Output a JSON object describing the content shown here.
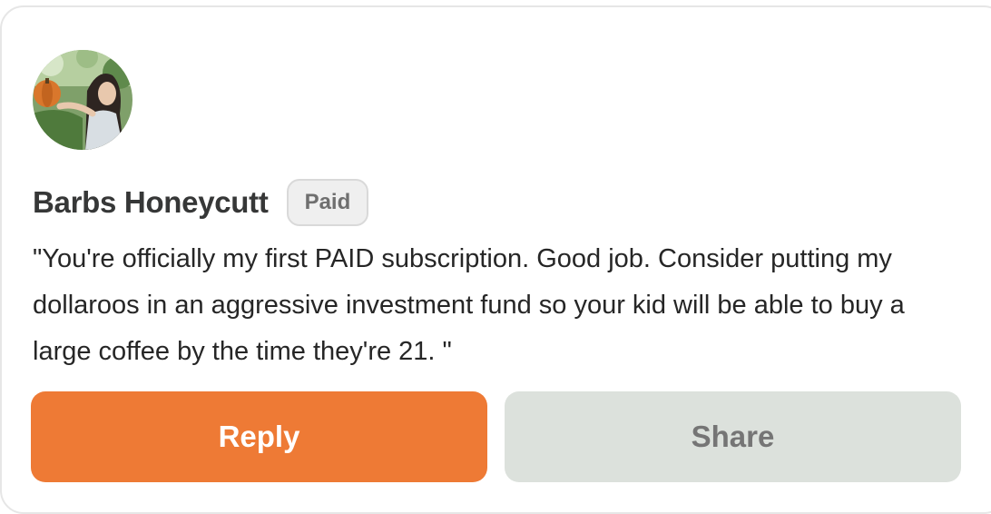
{
  "comment": {
    "author": "Barbs Honeycutt",
    "badge": "Paid",
    "avatar_icon": "user-photo-avatar",
    "text": "\"You're officially my first PAID subscription. Good job. Consider putting my dollaroos in an aggressive investment fund so your kid will be able to buy a large coffee by the time they're 21. \""
  },
  "actions": {
    "reply_label": "Reply",
    "share_label": "Share"
  },
  "colors": {
    "reply_bg": "#ee7a35",
    "share_bg": "#dce1dc",
    "text": "#262626",
    "badge_bg": "#efefef"
  }
}
